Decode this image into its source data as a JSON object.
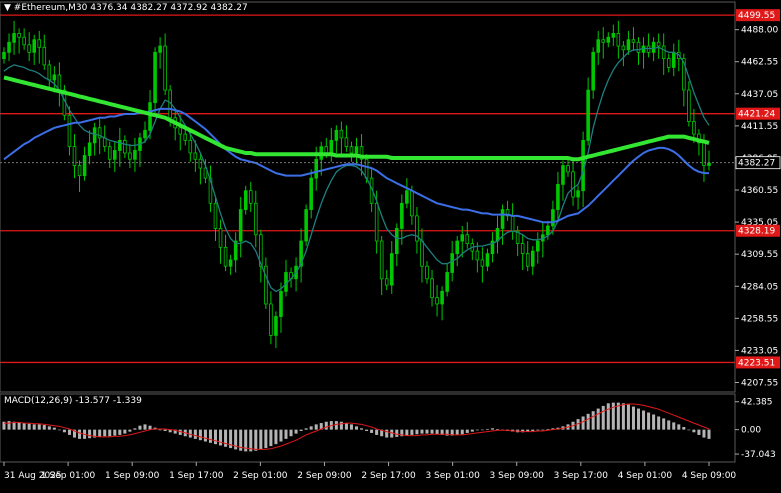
{
  "header": {
    "arrow": "▼",
    "symbol": "#Ethereum,M30",
    "ohlc": "4376.34 4382.27 4372.92 4382.27"
  },
  "colors": {
    "background": "#000000",
    "bull": "#00c800",
    "bear": "#00c800",
    "ma_fast": "#1e7f7f",
    "ma_mid": "#3c6ee6",
    "ma_slow": "#32e632",
    "hline": "#e01818",
    "macd_hist": "#b4b4b4",
    "macd_signal": "#e01818",
    "axis_text": "#ffffff",
    "current_price_box": "#000000"
  },
  "chart_data": {
    "type": "candlestick",
    "symbol": "#Ethereum",
    "timeframe": "M30",
    "ylim": [
      4200,
      4510
    ],
    "y_ticks": [
      "4488.00",
      "4462.55",
      "4437.05",
      "4411.55",
      "4386.05",
      "4360.55",
      "4335.05",
      "4309.55",
      "4284.05",
      "4258.55",
      "4233.05",
      "4207.55"
    ],
    "x_ticks": [
      "31 Aug 2025",
      "1 Sep 01:00",
      "1 Sep 09:00",
      "1 Sep 17:00",
      "2 Sep 01:00",
      "2 Sep 09:00",
      "2 Sep 17:00",
      "3 Sep 01:00",
      "3 Sep 09:00",
      "3 Sep 17:00",
      "4 Sep 01:00",
      "4 Sep 09:00"
    ],
    "levels": [
      {
        "label": "4499.55",
        "value": 4499.55
      },
      {
        "label": "4421.24",
        "value": 4421.24
      },
      {
        "label": "4328.19",
        "value": 4328.19
      },
      {
        "label": "4223.51",
        "value": 4223.51
      }
    ],
    "current_price": {
      "label": "4382.27",
      "value": 4382.27
    },
    "close": [
      4470,
      4478,
      4485,
      4482,
      4476,
      4470,
      4480,
      4474,
      4460,
      4448,
      4452,
      4440,
      4420,
      4395,
      4380,
      4372,
      4388,
      4398,
      4410,
      4402,
      4395,
      4385,
      4392,
      4400,
      4390,
      4385,
      4392,
      4402,
      4408,
      4430,
      4470,
      4475,
      4440,
      4418,
      4410,
      4405,
      4400,
      4390,
      4385,
      4378,
      4370,
      4350,
      4330,
      4315,
      4300,
      4305,
      4320,
      4345,
      4360,
      4350,
      4325,
      4300,
      4270,
      4245,
      4260,
      4280,
      4295,
      4290,
      4300,
      4320,
      4345,
      4370,
      4385,
      4395,
      4390,
      4400,
      4408,
      4402,
      4395,
      4390,
      4395,
      4385,
      4370,
      4350,
      4320,
      4290,
      4285,
      4310,
      4330,
      4350,
      4360,
      4340,
      4320,
      4300,
      4290,
      4275,
      4270,
      4280,
      4295,
      4310,
      4320,
      4325,
      4318,
      4312,
      4305,
      4300,
      4310,
      4320,
      4330,
      4345,
      4340,
      4328,
      4318,
      4310,
      4300,
      4312,
      4320,
      4325,
      4332,
      4345,
      4365,
      4380,
      4375,
      4355,
      4360,
      4400,
      4440,
      4470,
      4480,
      4478,
      4482,
      4485,
      4475,
      4472,
      4480,
      4478,
      4470,
      4475,
      4470,
      4478,
      4475,
      4465,
      4458,
      4470,
      4465,
      4440,
      4415,
      4405,
      4398,
      4380,
      4382
    ],
    "series": [
      {
        "name": "MA fast",
        "values": [
          4455,
          4458,
          4460,
          4459,
          4458,
          4456,
          4455,
          4453,
          4450,
          4448,
          4445,
          4440,
          4432,
          4424,
          4418,
          4412,
          4408,
          4406,
          4405,
          4404,
          4402,
          4400,
          4399,
          4398,
          4397,
          4396,
          4396,
          4397,
          4399,
          4405,
          4415,
          4425,
          4432,
          4430,
          4425,
          4418,
          4412,
          4405,
          4398,
          4390,
          4380,
          4368,
          4355,
          4342,
          4330,
          4322,
          4318,
          4318,
          4320,
          4318,
          4312,
          4302,
          4292,
          4283,
          4280,
          4282,
          4286,
          4290,
          4295,
          4302,
          4312,
          4325,
          4338,
          4350,
          4360,
          4368,
          4375,
          4378,
          4380,
          4380,
          4379,
          4376,
          4370,
          4362,
          4352,
          4340,
          4330,
          4325,
          4322,
          4322,
          4324,
          4325,
          4324,
          4320,
          4315,
          4310,
          4305,
          4302,
          4302,
          4304,
          4306,
          4310,
          4313,
          4315,
          4316,
          4316,
          4317,
          4318,
          4320,
          4324,
          4327,
          4328,
          4327,
          4325,
          4322,
          4321,
          4321,
          4322,
          4324,
          4328,
          4336,
          4348,
          4358,
          4362,
          4365,
          4375,
          4390,
          4410,
          4425,
          4438,
          4448,
          4456,
          4462,
          4466,
          4470,
          4472,
          4472,
          4473,
          4473,
          4473,
          4474,
          4472,
          4470,
          4470,
          4468,
          4462,
          4450,
          4438,
          4428,
          4418,
          4412
        ]
      },
      {
        "name": "MA mid",
        "values": [
          4385,
          4388,
          4391,
          4394,
          4397,
          4399,
          4402,
          4404,
          4406,
          4408,
          4410,
          4411,
          4412,
          4413,
          4414,
          4414,
          4415,
          4416,
          4417,
          4418,
          4418,
          4419,
          4419,
          4420,
          4421,
          4421,
          4421,
          4422,
          4422,
          4423,
          4424,
          4425,
          4425,
          4425,
          4424,
          4423,
          4421,
          4418,
          4415,
          4412,
          4409,
          4405,
          4401,
          4397,
          4393,
          4390,
          4387,
          4385,
          4384,
          4383,
          4382,
          4380,
          4378,
          4376,
          4374,
          4373,
          4372,
          4372,
          4372,
          4372,
          4373,
          4374,
          4375,
          4376,
          4377,
          4378,
          4379,
          4380,
          4381,
          4381,
          4381,
          4380,
          4379,
          4378,
          4376,
          4373,
          4370,
          4368,
          4366,
          4364,
          4362,
          4360,
          4358,
          4356,
          4354,
          4352,
          4350,
          4349,
          4348,
          4347,
          4346,
          4345,
          4345,
          4344,
          4343,
          4342,
          4342,
          4341,
          4341,
          4341,
          4341,
          4340,
          4340,
          4339,
          4338,
          4337,
          4336,
          4335,
          4335,
          4335,
          4336,
          4338,
          4340,
          4341,
          4342,
          4345,
          4348,
          4352,
          4356,
          4360,
          4364,
          4368,
          4372,
          4376,
          4380,
          4384,
          4387,
          4390,
          4392,
          4393,
          4394,
          4394,
          4393,
          4391,
          4388,
          4384,
          4380,
          4377,
          4375,
          4374,
          4374
        ]
      },
      {
        "name": "MA slow",
        "values": [
          4450,
          4449,
          4448,
          4447,
          4446,
          4445,
          4444,
          4443,
          4442,
          4441,
          4440,
          4439,
          4438,
          4437,
          4436,
          4435,
          4434,
          4433,
          4432,
          4431,
          4430,
          4429,
          4428,
          4427,
          4426,
          4425,
          4424,
          4423,
          4422,
          4421,
          4420,
          4419,
          4418,
          4416,
          4414,
          4412,
          4410,
          4408,
          4406,
          4404,
          4402,
          4400,
          4398,
          4396,
          4394,
          4393,
          4392,
          4391,
          4390,
          4390,
          4389,
          4389,
          4389,
          4389,
          4389,
          4389,
          4389,
          4389,
          4389,
          4389,
          4389,
          4389,
          4389,
          4389,
          4389,
          4389,
          4388,
          4388,
          4388,
          4388,
          4388,
          4387,
          4387,
          4387,
          4387,
          4387,
          4387,
          4386,
          4386,
          4386,
          4386,
          4386,
          4386,
          4386,
          4386,
          4386,
          4386,
          4386,
          4386,
          4386,
          4386,
          4386,
          4386,
          4386,
          4386,
          4386,
          4386,
          4386,
          4386,
          4386,
          4386,
          4386,
          4386,
          4386,
          4386,
          4386,
          4386,
          4386,
          4386,
          4386,
          4386,
          4386,
          4386,
          4385,
          4385,
          4386,
          4387,
          4388,
          4389,
          4390,
          4391,
          4392,
          4393,
          4394,
          4395,
          4396,
          4397,
          4398,
          4399,
          4400,
          4401,
          4402,
          4403,
          4403,
          4403,
          4403,
          4402,
          4401,
          4400,
          4399,
          4398
        ]
      }
    ],
    "macd": {
      "label": "MACD(12,26,9) -13.577 -1.339",
      "ylim": [
        -40,
        45
      ],
      "ticks": [
        "42.385",
        "0.00",
        "-37.043"
      ],
      "hist": [
        12,
        13,
        12,
        11,
        10,
        9,
        8,
        8,
        7,
        5,
        3,
        0,
        -4,
        -8,
        -12,
        -14,
        -14,
        -13,
        -12,
        -11,
        -10,
        -10,
        -9,
        -8,
        -6,
        -3,
        2,
        6,
        8,
        6,
        3,
        0,
        -2,
        -4,
        -6,
        -8,
        -10,
        -12,
        -14,
        -16,
        -18,
        -20,
        -22,
        -24,
        -26,
        -28,
        -30,
        -32,
        -33,
        -33,
        -32,
        -30,
        -28,
        -25,
        -22,
        -18,
        -14,
        -10,
        -6,
        -2,
        2,
        5,
        8,
        10,
        12,
        13,
        13,
        12,
        10,
        8,
        5,
        2,
        -2,
        -5,
        -8,
        -10,
        -12,
        -12,
        -11,
        -10,
        -9,
        -8,
        -7,
        -6,
        -6,
        -6,
        -7,
        -8,
        -9,
        -9,
        -8,
        -7,
        -5,
        -3,
        -1,
        0,
        1,
        2,
        1,
        -1,
        -2,
        -3,
        -4,
        -4,
        -3,
        -2,
        -1,
        0,
        1,
        2,
        3,
        5,
        8,
        12,
        16,
        20,
        24,
        28,
        32,
        36,
        40,
        41,
        41,
        40,
        38,
        35,
        32,
        29,
        26,
        23,
        20,
        17,
        14,
        11,
        8,
        4,
        0,
        -4,
        -8,
        -12,
        -14
      ],
      "signal": [
        10,
        10,
        11,
        11,
        10,
        10,
        9,
        9,
        8,
        7,
        6,
        5,
        3,
        1,
        -2,
        -5,
        -7,
        -9,
        -10,
        -11,
        -11,
        -11,
        -10,
        -10,
        -9,
        -8,
        -6,
        -4,
        -2,
        0,
        1,
        1,
        1,
        0,
        -1,
        -3,
        -5,
        -7,
        -9,
        -11,
        -13,
        -15,
        -17,
        -19,
        -21,
        -23,
        -25,
        -27,
        -28,
        -29,
        -30,
        -30,
        -30,
        -29,
        -27,
        -25,
        -22,
        -19,
        -16,
        -12,
        -8,
        -5,
        -2,
        1,
        4,
        6,
        8,
        9,
        10,
        10,
        9,
        8,
        6,
        4,
        1,
        -1,
        -3,
        -5,
        -7,
        -8,
        -9,
        -9,
        -9,
        -8,
        -8,
        -7,
        -7,
        -7,
        -7,
        -8,
        -8,
        -8,
        -7,
        -6,
        -5,
        -4,
        -3,
        -2,
        -1,
        -1,
        -1,
        -2,
        -2,
        -3,
        -3,
        -3,
        -2,
        -2,
        -1,
        0,
        1,
        2,
        4,
        6,
        9,
        12,
        16,
        20,
        24,
        28,
        31,
        34,
        36,
        38,
        39,
        39,
        38,
        37,
        35,
        33,
        31,
        28,
        25,
        22,
        19,
        16,
        13,
        10,
        7,
        4,
        1
      ]
    }
  }
}
